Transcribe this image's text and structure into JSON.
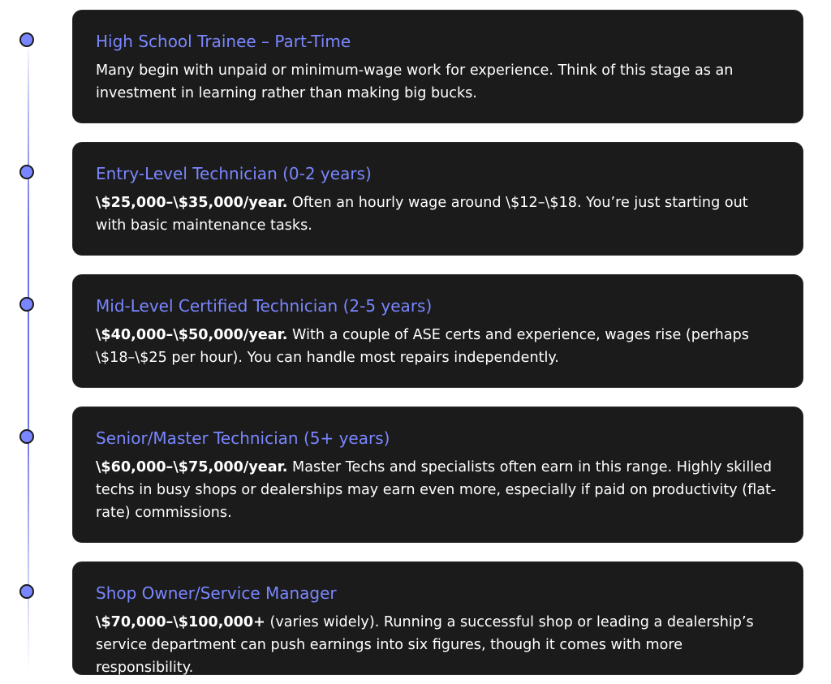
{
  "items": [
    {
      "title": "High School Trainee – Part-Time",
      "highlight": "",
      "text": "Many begin with unpaid or minimum-wage work for experience. Think of this stage as an investment in learning rather than making big bucks."
    },
    {
      "title": "Entry-Level Technician (0-2 years)",
      "highlight": "\\$25,000–\\$35,000/year.",
      "text": " Often an hourly wage around \\$12–\\$18. You’re just starting out with basic maintenance tasks."
    },
    {
      "title": "Mid-Level Certified Technician (2-5 years)",
      "highlight": "\\$40,000–\\$50,000/year.",
      "text": " With a couple of ASE certs and experience, wages rise (perhaps \\$18–\\$25 per hour). You can handle most repairs independently."
    },
    {
      "title": "Senior/Master Technician (5+ years)",
      "highlight": "\\$60,000–\\$75,000/year.",
      "text": " Master Techs and specialists often earn in this range. Highly skilled techs in busy shops or dealerships may earn even more, especially if paid on productivity (flat-rate) commissions."
    },
    {
      "title": "Shop Owner/Service Manager",
      "highlight": "\\$70,000–\\$100,000+",
      "text": " (varies widely). Running a successful shop or leading a dealership’s service department can push earnings into six figures, though it comes with more responsibility."
    }
  ],
  "colors": {
    "accent": "#7a86ff",
    "card_bg": "#1b1b1b",
    "text": "#ffffff"
  }
}
